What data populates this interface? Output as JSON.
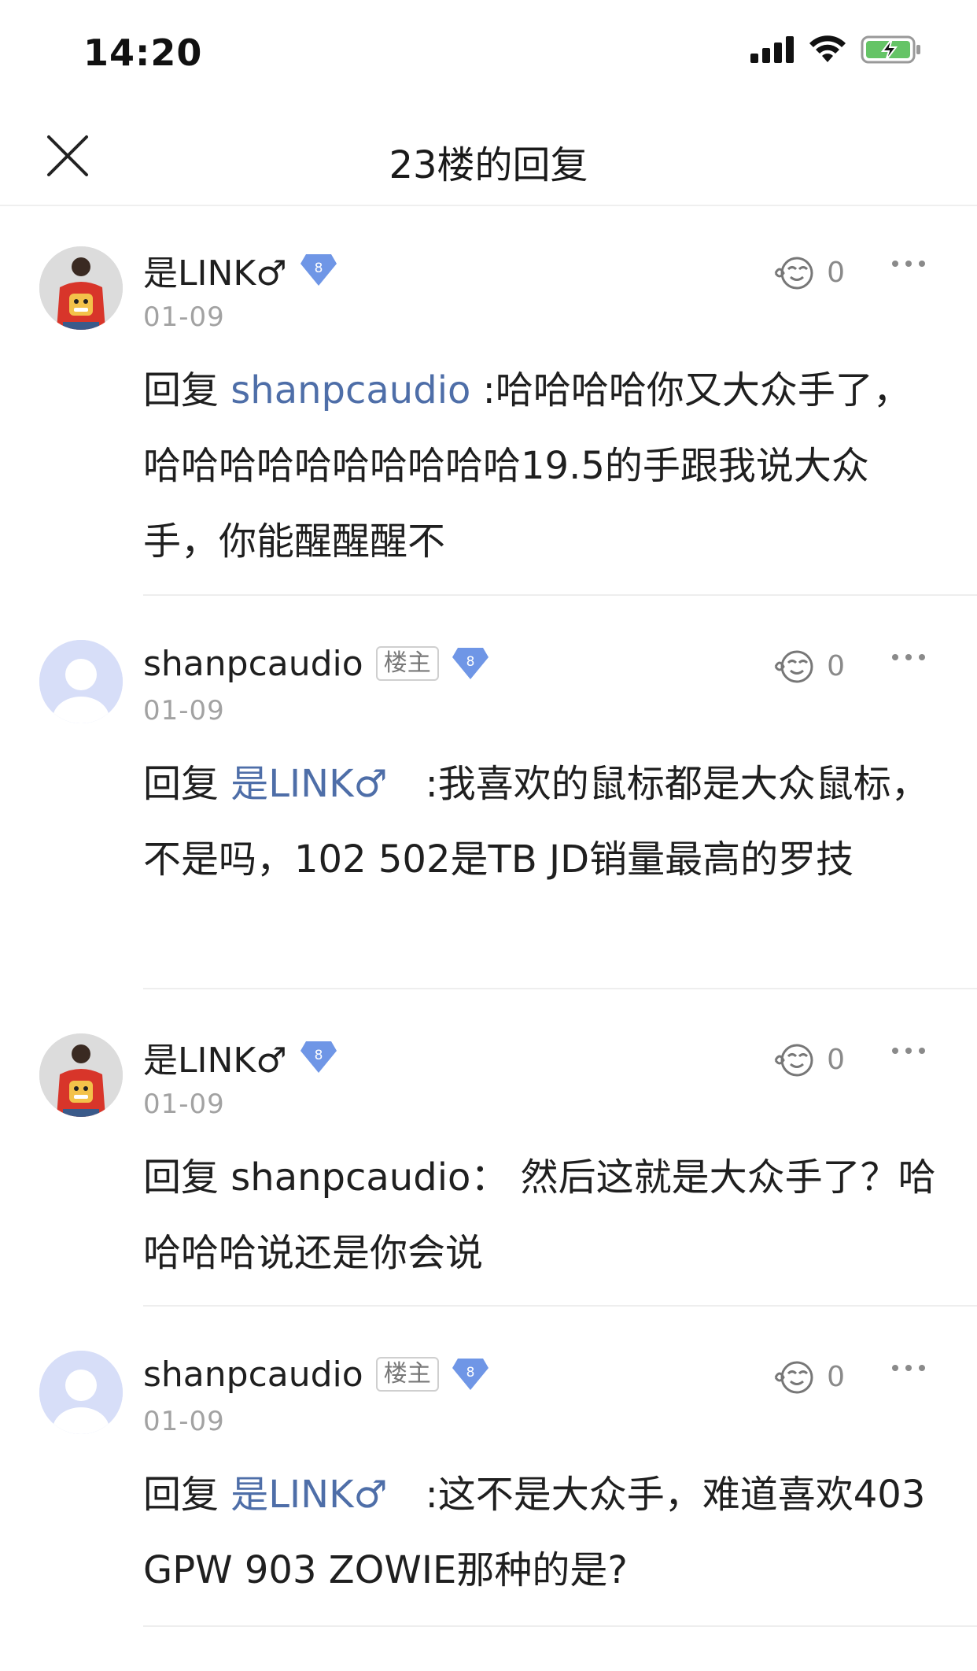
{
  "status": {
    "time": "14:20"
  },
  "nav": {
    "title": "23楼的回复"
  },
  "comments": [
    {
      "user": "是LINK♂",
      "level": "8",
      "date": "01-09",
      "likes": "0",
      "reply_prefix": "回复",
      "mention": "shanpcaudio",
      "text": " :哈哈哈哈你又大众手了，哈哈哈哈哈哈哈哈哈哈19.5的手跟我说大众手，你能醒醒醒不"
    },
    {
      "user": "shanpcaudio",
      "owner_badge": "楼主",
      "level": "8",
      "date": "01-09",
      "likes": "0",
      "reply_prefix": "回复",
      "mention": "是LINK♂",
      "text": "　:我喜欢的鼠标都是大众鼠标，不是吗，102 502是TB JD销量最高的罗技"
    },
    {
      "user": "是LINK♂",
      "level": "8",
      "date": "01-09",
      "likes": "0",
      "reply_prefix": "回复",
      "text": "shanpcaudio： 然后这就是大众手了？哈哈哈哈说还是你会说"
    },
    {
      "user": "shanpcaudio",
      "owner_badge": "楼主",
      "level": "8",
      "date": "01-09",
      "likes": "0",
      "reply_prefix": "回复",
      "mention": "是LINK♂",
      "text": "　:这不是大众手，难道喜欢403 GPW 903 ZOWIE那种的是?"
    }
  ],
  "colors": {
    "mention": "#4e6ea8",
    "badge": "#6f96e6",
    "date": "#a2a2a2"
  }
}
